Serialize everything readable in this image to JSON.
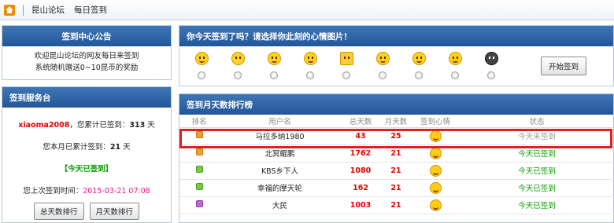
{
  "breadcrumb": {
    "forum": "昆山论坛",
    "page": "每日签到"
  },
  "notice": {
    "title": "签到中心公告",
    "line1": "欢迎昆山论坛的网友每日来签到",
    "line2": "系统随机赠送0~10昆币的奖励"
  },
  "service": {
    "title": "签到服务台",
    "username": "xiaoma2008",
    "total_prefix": "，您累计已签到：",
    "total_days": "313",
    "day_unit": "天",
    "month_prefix": "您本月已累计签到：",
    "month_days": "21",
    "signed_status": "【今天已签到】",
    "last_time_label": "您上次签到时间：",
    "last_time": "2015-03-21 07:08",
    "btn_total": "总天数排行",
    "btn_month": "月天数排行"
  },
  "mood": {
    "title": "你今天签到了吗？请选择你此刻的心情图片！",
    "faces": [
      "happy-face-icon",
      "sad-face-icon",
      "angry-face-icon",
      "sleepy-face-icon",
      "fist-icon",
      "thinking-face-icon",
      "pirate-face-icon",
      "dizzy-face-icon",
      "black-face-icon"
    ],
    "start_button": "开始签到"
  },
  "rank": {
    "title": "签到月天数排行榜",
    "headers": [
      "排名",
      "用户名",
      "总天数",
      "月天数",
      "签到心情",
      "状态"
    ],
    "rows": [
      {
        "badge": "orange",
        "name": "马拉多纳1980",
        "total": "43",
        "month": "25",
        "status": "今天未签到"
      },
      {
        "badge": "orange",
        "name": "北冥鲲鹏",
        "total": "1762",
        "month": "21",
        "status": "今天已签到"
      },
      {
        "badge": "green",
        "name": "KBS乡下人",
        "total": "1080",
        "month": "21",
        "status": "今天已签到"
      },
      {
        "badge": "green",
        "name": "幸福的摩天轮",
        "total": "162",
        "month": "21",
        "status": "今天已签到"
      },
      {
        "badge": "purple",
        "name": "大民",
        "total": "1003",
        "month": "21",
        "status": "今天已签到"
      }
    ]
  }
}
